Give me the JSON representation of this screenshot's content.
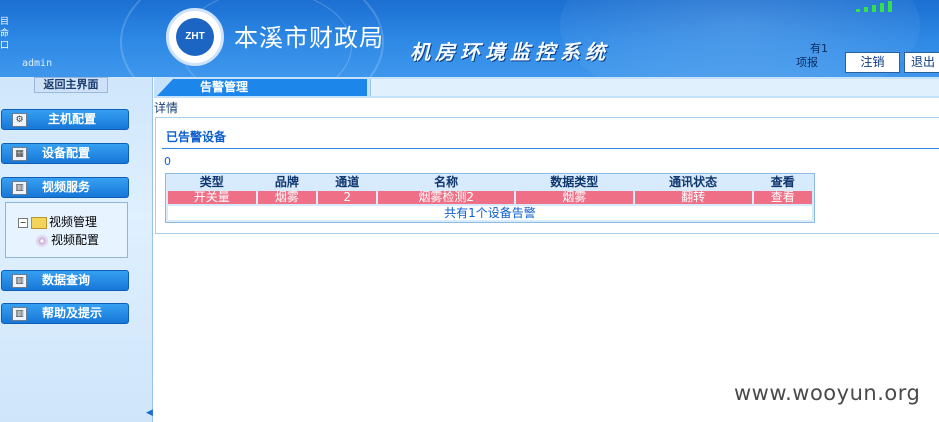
{
  "header": {
    "left_icons": [
      "目",
      "命",
      "口"
    ],
    "user": "admin",
    "logo_text": "ZHT",
    "org_name": "本溪市财政局",
    "system_name": "机房环境监控系统",
    "alarm_count_line1": "有1",
    "alarm_count_line2": "项报",
    "logout_label": "注销",
    "exit_label": "退出"
  },
  "sidebar": {
    "back_label": "返回主界面",
    "items": [
      {
        "label": "主机配置",
        "icon": "gear-icon"
      },
      {
        "label": "设备配置",
        "icon": "device-icon"
      },
      {
        "label": "视频服务",
        "icon": "chart-icon"
      },
      {
        "label": "数据查询",
        "icon": "chart-icon"
      },
      {
        "label": "帮助及提示",
        "icon": "chart-icon"
      }
    ],
    "video_tree": {
      "folder_label": "视频管理",
      "child_label": "视频配置"
    }
  },
  "main": {
    "tab_label": "告警管理",
    "detail_label": "详情",
    "panel_title": "已告警设备",
    "zero_text": "0",
    "table": {
      "headers": [
        "类型",
        "品牌",
        "通道",
        "名称",
        "数据类型",
        "通讯状态",
        "查看"
      ],
      "rows": [
        [
          "开关量",
          "烟雾",
          "2",
          "烟雾检测2",
          "烟雾",
          "翻转",
          "查看"
        ]
      ],
      "footer": "共有1个设备告警"
    }
  },
  "watermark": "www.wooyun.org",
  "colors": {
    "header_blue": "#1b6fd1",
    "nav_button": "#1777d8",
    "alarm_row": "#ee6f86",
    "title_blue": "#0d5fcf"
  }
}
